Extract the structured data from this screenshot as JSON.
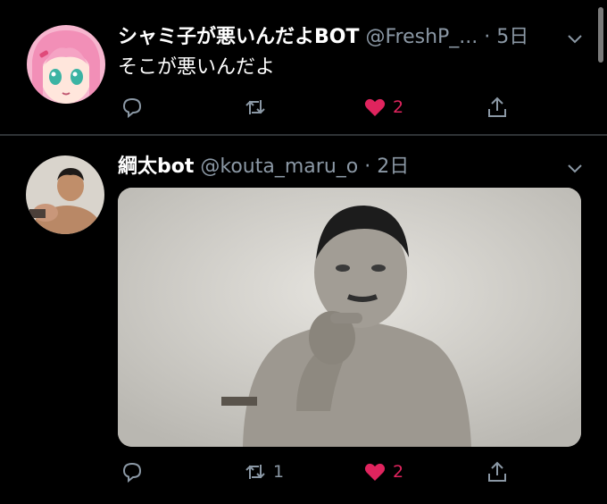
{
  "tweets": [
    {
      "display_name": "シャミ子が悪いんだよBOT",
      "handle": "@FreshP_...",
      "time": "· 5日",
      "text": "そこが悪いんだよ",
      "actions": {
        "reply_count": "",
        "retweet_count": "",
        "like_count": "2"
      },
      "avatar_icon": "anime-girl-avatar",
      "liked": true
    },
    {
      "display_name": "綱太bot",
      "handle": "@kouta_maru_o",
      "time": "· 2日",
      "actions": {
        "reply_count": "",
        "retweet_count": "1",
        "like_count": "2"
      },
      "avatar_icon": "man-avatar",
      "media_icon": "photo-man-pointing",
      "liked": true
    }
  ],
  "colors": {
    "background": "#000000",
    "muted": "#8b98a5",
    "like": "#e0245e",
    "divider": "#2f3336"
  }
}
